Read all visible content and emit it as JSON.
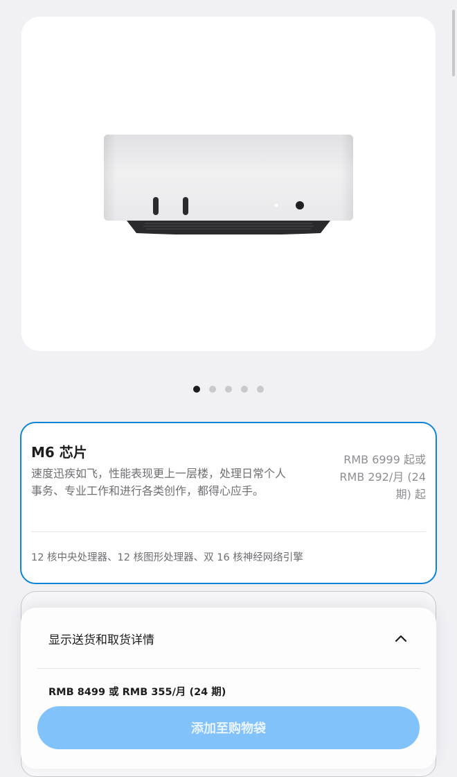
{
  "gallery": {
    "image_alt": "Mac mini product image",
    "dots": 5,
    "active_dot": 0
  },
  "option": {
    "title": "M6 芯片",
    "description": "速度迅疾如飞，性能表现更上一层楼，处理日常个人事务、专业工作和进行各类创作，都得心应手。",
    "price_line1": "RMB 6999 起或",
    "price_line2": "RMB 292/月 (24",
    "price_line3": "期) 起",
    "specs": "12 核中央处理器、12 核图形处理器、双 16 核神经网络引擎",
    "selected": true
  },
  "sheet": {
    "delivery_label": "显示送货和取货详情",
    "total_price": "RMB 8499 或 RMB 355/月 (24 期)",
    "add_button_label": "添加至购物袋"
  },
  "colors": {
    "accent_border": "#0a84d6",
    "button_bg": "#82c2fb",
    "page_bg": "#f0f0f5"
  },
  "icons": {
    "chevron": "chevron-up-icon"
  }
}
